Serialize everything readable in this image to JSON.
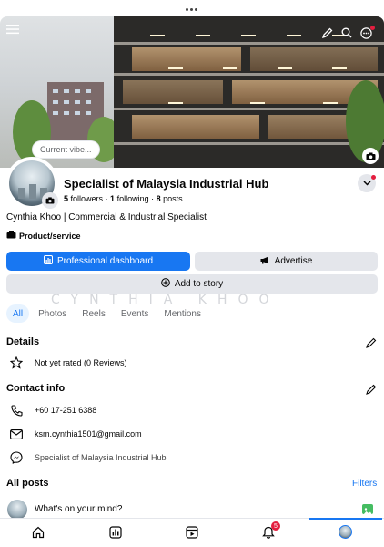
{
  "header": {
    "cover_caption": "Current vibe...",
    "page_name": "Specialist of Malaysia Industrial Hub",
    "followers": "5",
    "followers_label": "followers",
    "following": "1",
    "following_label": "following",
    "posts": "8",
    "posts_label": "posts",
    "bio": "Cynthia Khoo | Commercial & Industrial Specialist",
    "category": "Product/service"
  },
  "actions": {
    "professional_dashboard": "Professional dashboard",
    "advertise": "Advertise",
    "add_to_story": "Add to story"
  },
  "watermark": "CYNTHIA KHOO",
  "tabs": [
    "All",
    "Photos",
    "Reels",
    "Events",
    "Mentions"
  ],
  "details": {
    "title": "Details",
    "rating": "Not yet rated (0 Reviews)"
  },
  "contact": {
    "title": "Contact info",
    "phone": "+60 17-251 6388",
    "email": "ksm.cynthia1501@gmail.com",
    "messenger": "Specialist of Malaysia Industrial Hub"
  },
  "posts_section": {
    "title": "All posts",
    "filters": "Filters",
    "composer_placeholder": "What's on your mind?"
  },
  "bottom_nav": {
    "notifications_badge": "5"
  },
  "colors": {
    "accent": "#1877f2",
    "badge": "#e41e3f",
    "button_grey": "#e4e6eb"
  },
  "icons": [
    "menu-icon",
    "edit-icon",
    "search-icon",
    "more-icon",
    "camera-icon",
    "chevron-down-icon",
    "dashboard-icon",
    "megaphone-icon",
    "plus-circle-icon",
    "pencil-icon",
    "star-icon",
    "phone-icon",
    "mail-icon",
    "messenger-icon",
    "photo-icon",
    "home-icon",
    "insights-icon",
    "video-icon",
    "bell-icon"
  ]
}
